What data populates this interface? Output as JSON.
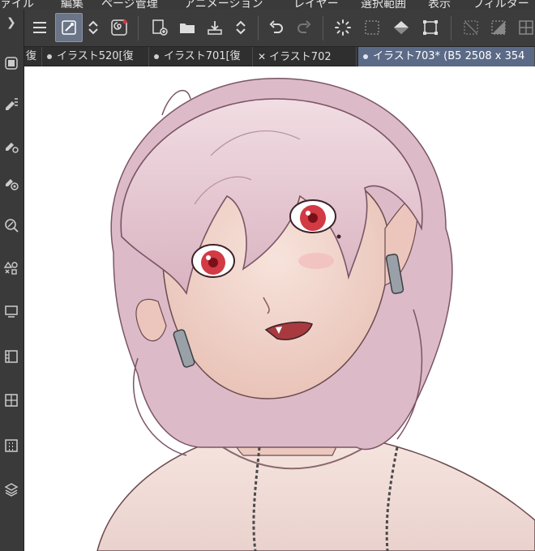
{
  "menu": {
    "items": [
      "ァイル",
      "編集",
      "ページ管理",
      "アニメーション",
      "レイヤー",
      "選択範囲",
      "表示",
      "フィルター"
    ]
  },
  "toolbar": {
    "icons": [
      "menu-icon",
      "pen-settings-icon",
      "up-down-icon",
      "spiral-icon",
      "new-page-icon",
      "open-folder-icon",
      "export-icon",
      "up-down-icon",
      "undo-icon",
      "redo-icon",
      "loading-icon",
      "select-all-icon",
      "fill-icon",
      "transform-icon",
      "clear-selection-icon",
      "invert-selection-icon",
      "grid-icon"
    ]
  },
  "tabs": [
    {
      "label": "復",
      "active": false,
      "closable": false
    },
    {
      "label": "イラスト520[復",
      "active": false,
      "closable": false
    },
    {
      "label": "イラスト701[復",
      "active": false,
      "closable": false
    },
    {
      "label": "イラスト702",
      "active": false,
      "closable": true
    },
    {
      "label": "イラスト703* (B5 2508 x 354",
      "active": true,
      "closable": false
    }
  ],
  "colors": {
    "accent": "#5b6a86",
    "hair": "#e8c9d2",
    "eyes": "#d23a44",
    "skin": "#f3d9cf"
  }
}
